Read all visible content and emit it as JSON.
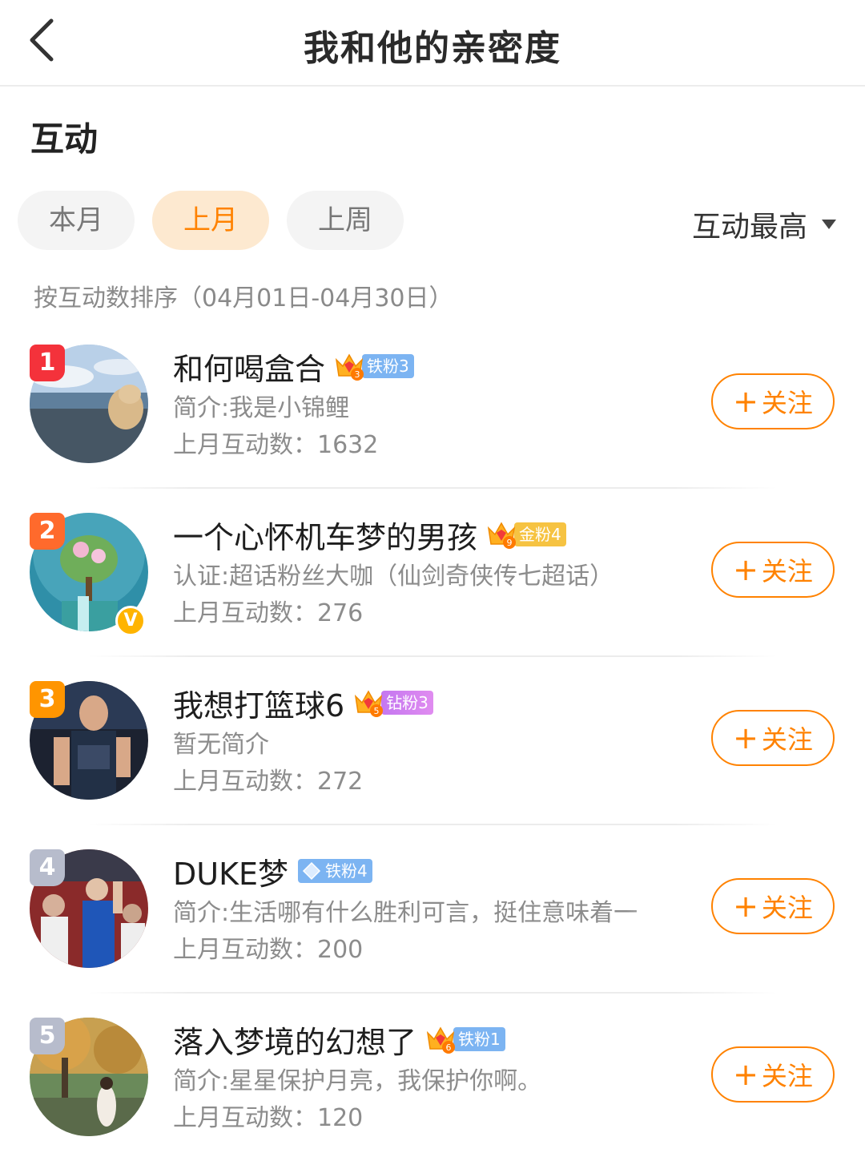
{
  "header": {
    "title": "我和他的亲密度",
    "back_icon": "chevron-left-icon"
  },
  "section": {
    "title": "互动"
  },
  "tabs": [
    {
      "label": "本月",
      "active": false
    },
    {
      "label": "上月",
      "active": true
    },
    {
      "label": "上周",
      "active": false
    }
  ],
  "sort": {
    "label": "互动最高",
    "icon": "caret-down-icon",
    "description": "按互动数排序（04月01日-04月30日）"
  },
  "colors": {
    "accent": "#ff8200",
    "tab_active_bg": "#fde9d0"
  },
  "follow_label": "关注",
  "users": [
    {
      "rank": "1",
      "name": "和何喝盒合",
      "crown_level": "3",
      "fan_label": "铁粉3",
      "fan_type": "iron",
      "intro": "简介:我是小锦鲤",
      "count": "上月互动数：1632",
      "verified": false
    },
    {
      "rank": "2",
      "name": "一个心怀机车梦的男孩",
      "crown_level": "9",
      "fan_label": "金粉4",
      "fan_type": "gold",
      "intro": "认证:超话粉丝大咖（仙剑奇侠传七超话）",
      "count": "上月互动数：276",
      "verified": true,
      "verified_mark": "V"
    },
    {
      "rank": "3",
      "name": "我想打篮球6",
      "crown_level": "5",
      "fan_label": "钻粉3",
      "fan_type": "diamond",
      "intro": "暂无简介",
      "count": "上月互动数：272",
      "verified": false
    },
    {
      "rank": "4",
      "name": "DUKE梦",
      "crown_level": "",
      "fan_label": "铁粉4",
      "fan_type": "iron-gem",
      "intro": "简介:生活哪有什么胜利可言，挺住意味着一",
      "count": "上月互动数：200",
      "verified": false
    },
    {
      "rank": "5",
      "name": "落入梦境的幻想了",
      "crown_level": "6",
      "fan_label": "铁粉1",
      "fan_type": "iron",
      "intro": "简介:星星保护月亮，我保护你啊。",
      "count": "上月互动数：120",
      "verified": false
    }
  ]
}
